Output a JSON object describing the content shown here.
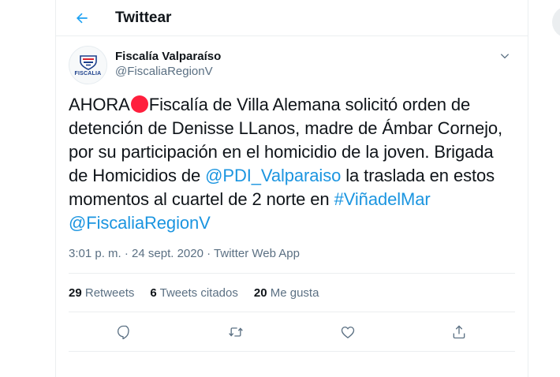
{
  "header": {
    "title": "Twittear",
    "back_icon": "arrow-left-icon"
  },
  "tweet": {
    "author": {
      "name": "Fiscalía Valparaíso",
      "handle": "@FiscaliaRegionV",
      "avatar_text": "FISCALIA"
    },
    "text": {
      "prefix": "AHORA",
      "part1": "Fiscalía de Villa Alemana solicitó orden de detención de Denisse LLanos, madre de Ámbar Cornejo, por su participación en el homicidio de la joven. Brigada de Homicidios de ",
      "mention1": "@PDI_Valparaiso",
      "part2": " la traslada en estos momentos al cuartel de 2 norte en ",
      "hashtag": "#ViñadelMar",
      "mention2": "@FiscaliaRegionV"
    },
    "meta": {
      "time": "3:01 p. m.",
      "separator1": " · ",
      "date": "24 sept. 2020",
      "separator2": " · ",
      "source": "Twitter Web App"
    },
    "stats": {
      "retweets_count": "29",
      "retweets_label": "Retweets",
      "quotes_count": "6",
      "quotes_label": "Tweets citados",
      "likes_count": "20",
      "likes_label": "Me gusta"
    },
    "actions": [
      "reply-icon",
      "retweet-icon",
      "like-icon",
      "share-icon"
    ]
  },
  "colors": {
    "accent": "#1b95e0",
    "text_primary": "#0f1419",
    "text_secondary": "#5b7083",
    "red_dot": "#ff1f3d",
    "border": "#ebeef0"
  }
}
